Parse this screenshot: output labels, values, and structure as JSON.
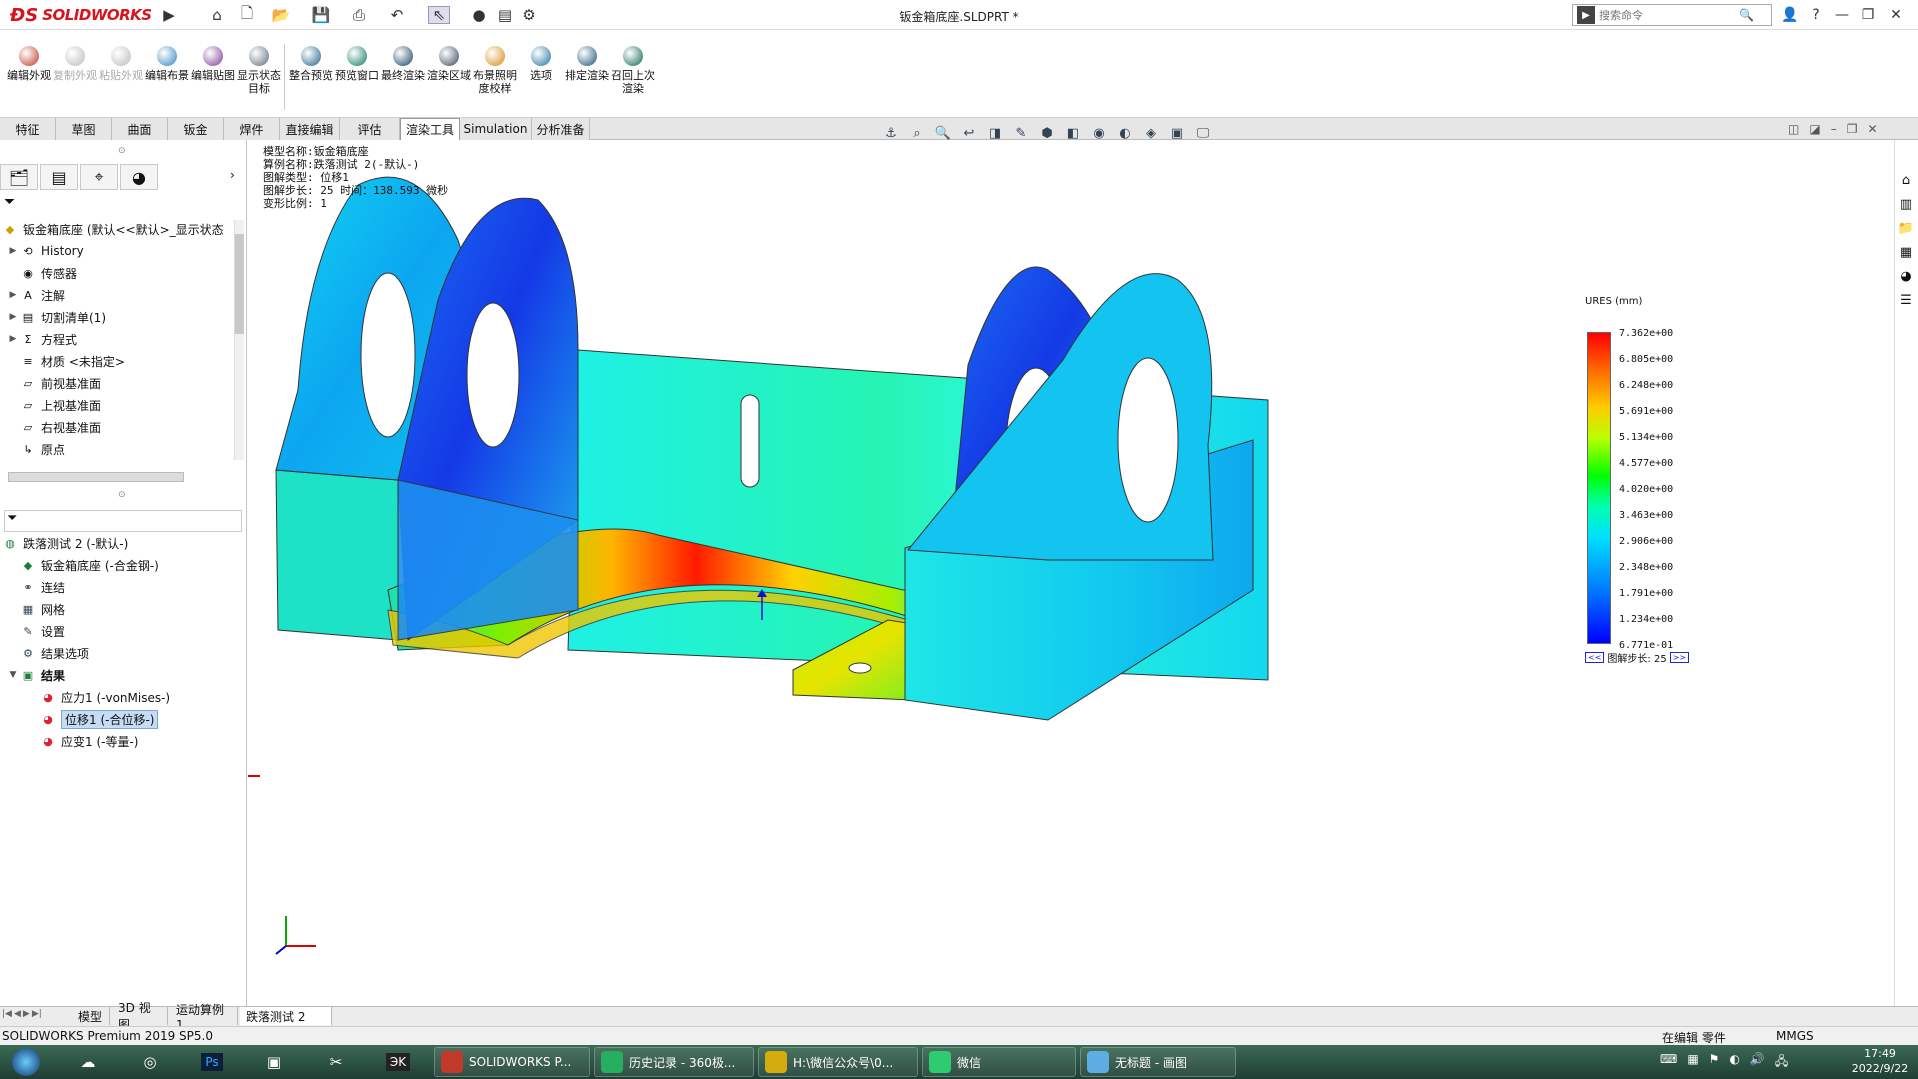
{
  "app": {
    "brand": "SOLIDWORKS",
    "document_title": "钣金箱底座.SLDPRT *",
    "search_placeholder": "搜索命令"
  },
  "ribbon": {
    "buttons": [
      {
        "label": "编辑外观",
        "enabled": true,
        "icon": "appearance-icon",
        "color": "#c0392b"
      },
      {
        "label": "复制外观",
        "enabled": false,
        "icon": "copy-appearance-icon",
        "color": "#bbbbbb"
      },
      {
        "label": "粘贴外观",
        "enabled": false,
        "icon": "paste-appearance-icon",
        "color": "#bbbbbb"
      },
      {
        "label": "编辑布景",
        "enabled": true,
        "icon": "scene-icon",
        "color": "#2e86c1"
      },
      {
        "label": "编辑贴图",
        "enabled": true,
        "icon": "decal-icon",
        "color": "#7d3c98"
      },
      {
        "label": "显示状态目标",
        "enabled": true,
        "icon": "display-state-icon",
        "color": "#5d6d7e"
      },
      {
        "label": "整合预览",
        "enabled": true,
        "icon": "integrated-preview-icon",
        "color": "#1f618d"
      },
      {
        "label": "预览窗口",
        "enabled": true,
        "icon": "preview-window-icon",
        "color": "#117a65"
      },
      {
        "label": "最终渲染",
        "enabled": true,
        "icon": "final-render-icon",
        "color": "#154360"
      },
      {
        "label": "渲染区域",
        "enabled": true,
        "icon": "render-region-icon",
        "color": "#34495e"
      },
      {
        "label": "布景照明度校样",
        "enabled": true,
        "icon": "lighting-proof-icon",
        "color": "#d68910"
      },
      {
        "label": "选项",
        "enabled": true,
        "icon": "options-icon",
        "color": "#2471a3"
      },
      {
        "label": "排定渲染",
        "enabled": true,
        "icon": "schedule-render-icon",
        "color": "#1a5276"
      },
      {
        "label": "召回上次渲染",
        "enabled": true,
        "icon": "recall-render-icon",
        "color": "#0e6655"
      }
    ]
  },
  "tabs": [
    {
      "label": "特征"
    },
    {
      "label": "草图"
    },
    {
      "label": "曲面"
    },
    {
      "label": "钣金"
    },
    {
      "label": "焊件"
    },
    {
      "label": "直接编辑"
    },
    {
      "label": "评估"
    },
    {
      "label": "渲染工具",
      "active": true
    },
    {
      "label": "Simulation"
    },
    {
      "label": "分析准备"
    }
  ],
  "feature_tree": {
    "root": "钣金箱底座 (默认<<默认>_显示状态",
    "items": [
      {
        "label": "History",
        "icon": "history-icon",
        "expand": true
      },
      {
        "label": "传感器",
        "icon": "sensor-icon",
        "expand": false
      },
      {
        "label": "注解",
        "icon": "annotation-icon",
        "expand": true
      },
      {
        "label": "切割清单(1)",
        "icon": "cut-list-icon",
        "expand": true
      },
      {
        "label": "方程式",
        "icon": "equation-icon",
        "expand": true
      },
      {
        "label": "材质 <未指定>",
        "icon": "material-icon",
        "expand": false
      },
      {
        "label": "前视基准面",
        "icon": "plane-icon",
        "expand": false
      },
      {
        "label": "上视基准面",
        "icon": "plane-icon",
        "expand": false
      },
      {
        "label": "右视基准面",
        "icon": "plane-icon",
        "expand": false
      },
      {
        "label": "原点",
        "icon": "origin-icon",
        "expand": false
      }
    ]
  },
  "sim_tree": {
    "root": "跌落测试 2 (-默认-)",
    "items": [
      {
        "label": "钣金箱底座 (-合金钢-)",
        "icon": "part-icon",
        "indent": 1
      },
      {
        "label": "连结",
        "icon": "connection-icon",
        "indent": 1
      },
      {
        "label": "网格",
        "icon": "mesh-icon",
        "indent": 1
      },
      {
        "label": "设置",
        "icon": "setup-icon",
        "indent": 1
      },
      {
        "label": "结果选项",
        "icon": "result-options-icon",
        "indent": 1
      },
      {
        "label": "结果",
        "icon": "results-folder-icon",
        "indent": 1,
        "expanded": true
      },
      {
        "label": "应力1 (-vonMises-)",
        "icon": "plot-icon",
        "indent": 2
      },
      {
        "label": "位移1 (-合位移-)",
        "icon": "plot-icon",
        "indent": 2,
        "selected": true
      },
      {
        "label": "应变1 (-等量-)",
        "icon": "plot-icon",
        "indent": 2
      }
    ]
  },
  "plot_info": {
    "line1": "模型名称:钣金箱底座",
    "line2": "算例名称:跌落测试 2(-默认-)",
    "line3": "图解类型: 位移1",
    "line4": "图解步长: 25   时间：138.593 微秒",
    "line5": "变形比例: 1"
  },
  "legend": {
    "title": "URES (mm)",
    "values": [
      "7.362e+00",
      "6.805e+00",
      "6.248e+00",
      "5.691e+00",
      "5.134e+00",
      "4.577e+00",
      "4.020e+00",
      "3.463e+00",
      "2.906e+00",
      "2.348e+00",
      "1.791e+00",
      "1.234e+00",
      "6.771e-01"
    ],
    "step_label": "图解步长: 25",
    "prev": "<<",
    "next": ">>"
  },
  "bottom_tabs": [
    {
      "label": "模型"
    },
    {
      "label": "3D 视图"
    },
    {
      "label": "运动算例1"
    },
    {
      "label": "跌落测试 2"
    }
  ],
  "status": {
    "left": "SOLIDWORKS Premium 2019 SP5.0",
    "editing": "在编辑 零件",
    "units": "MMGS"
  },
  "taskbar": {
    "apps": [
      {
        "label": "SOLIDWORKS P...",
        "color": "#c0392b"
      },
      {
        "label": "历史记录 - 360极...",
        "color": "#27ae60"
      },
      {
        "label": "H:\\微信公众号\\0...",
        "color": "#d4ac0d"
      },
      {
        "label": "微信",
        "color": "#2ecc71"
      },
      {
        "label": "无标题 - 画图",
        "color": "#5dade2"
      }
    ],
    "time": "17:49",
    "date": "2022/9/22"
  }
}
